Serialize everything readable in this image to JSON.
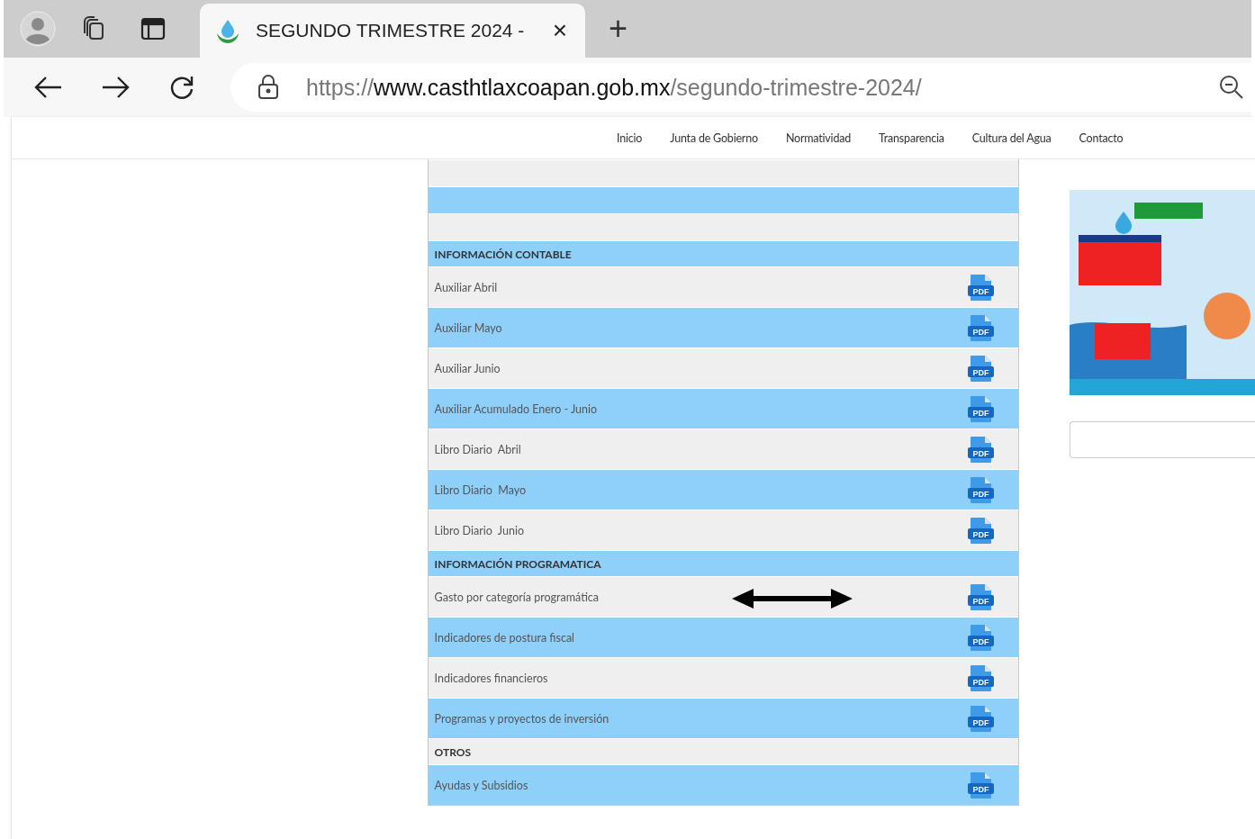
{
  "browser": {
    "tab": {
      "title": "SEGUNDO TRIMESTRE 2024 -",
      "close": "×",
      "selected": true
    },
    "new_tab": "+",
    "address": {
      "scheme": "https://",
      "host": "www.casthtlaxcoapan.gob.mx",
      "path": "/segundo-trimestre-2024/"
    }
  },
  "nav": [
    "Inicio",
    "Junta de Gobierno",
    "Normatividad",
    "Transparencia",
    "Cultura del Agua",
    "Contacto"
  ],
  "table": {
    "rows": [
      {
        "kind": "blank"
      },
      {
        "kind": "blank"
      },
      {
        "kind": "blank"
      },
      {
        "kind": "section",
        "label": "INFORMACIÓN CONTABLE"
      },
      {
        "kind": "document",
        "label": "Auxiliar Abril",
        "icon_text": "PDF"
      },
      {
        "kind": "document",
        "label": "Auxiliar Mayo",
        "icon_text": "PDF"
      },
      {
        "kind": "document",
        "label": "Auxiliar Junio",
        "icon_text": "PDF"
      },
      {
        "kind": "document",
        "label": "Auxiliar Acumulado Enero - Junio",
        "icon_text": "PDF"
      },
      {
        "kind": "document",
        "label": "Libro Diario  Abril",
        "icon_text": "PDF"
      },
      {
        "kind": "document",
        "label": "Libro Diario  Mayo",
        "icon_text": "PDF"
      },
      {
        "kind": "document",
        "label": "Libro Diario  Junio",
        "icon_text": "PDF"
      },
      {
        "kind": "section",
        "label": "INFORMACIÓN PROGRAMATICA"
      },
      {
        "kind": "document",
        "label": "Gasto por categoría programática",
        "icon_text": "PDF",
        "arrow": true
      },
      {
        "kind": "document",
        "label": "Indicadores de postura fiscal",
        "icon_text": "PDF"
      },
      {
        "kind": "document",
        "label": "Indicadores financieros",
        "icon_text": "PDF"
      },
      {
        "kind": "document",
        "label": "Programas y proyectos de inversión",
        "icon_text": "PDF"
      },
      {
        "kind": "section",
        "label": "OTROS"
      },
      {
        "kind": "document",
        "label": "Ayudas y Subsidios",
        "icon_text": "PDF"
      }
    ]
  }
}
